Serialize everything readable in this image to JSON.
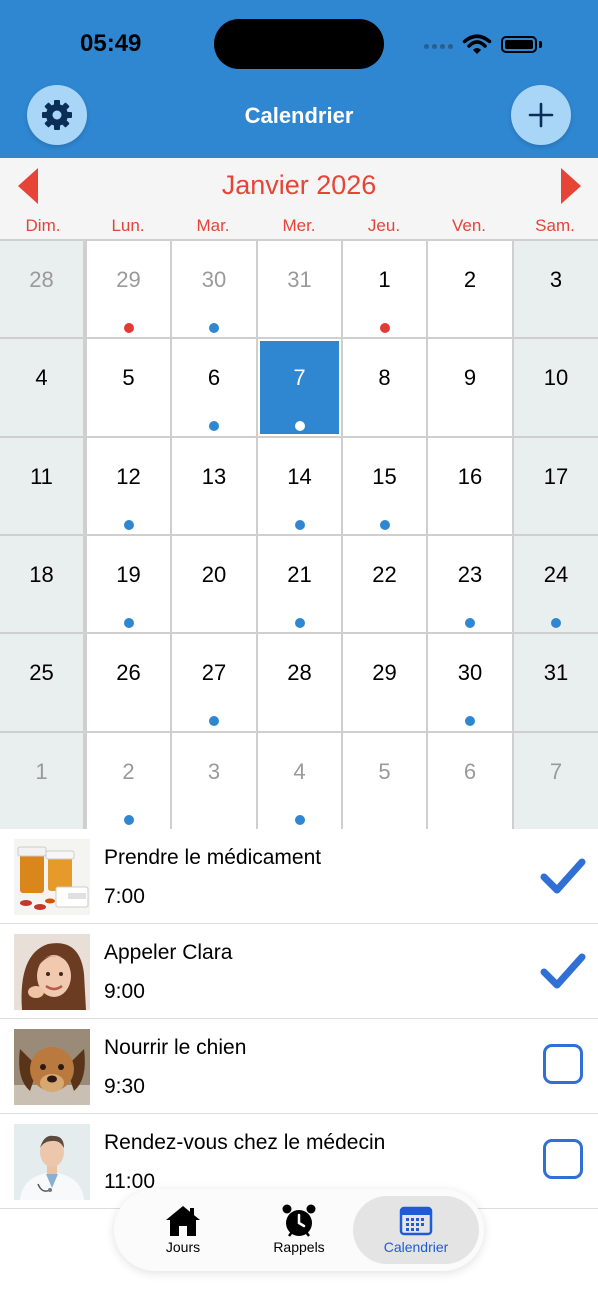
{
  "status": {
    "time": "05:49"
  },
  "header": {
    "title": "Calendrier",
    "settings_icon": "gear-icon",
    "add_icon": "plus-icon"
  },
  "calendar": {
    "month_title": "Janvier 2026",
    "weekdays": [
      "Dim.",
      "Lun.",
      "Mar.",
      "Mer.",
      "Jeu.",
      "Ven.",
      "Sam."
    ],
    "selected_day": "7",
    "weeks": [
      [
        {
          "d": "28",
          "out": true,
          "dot": ""
        },
        {
          "d": "29",
          "out": true,
          "dot": "red"
        },
        {
          "d": "30",
          "out": true,
          "dot": "blue"
        },
        {
          "d": "31",
          "out": true,
          "dot": ""
        },
        {
          "d": "1",
          "out": false,
          "dot": "red"
        },
        {
          "d": "2",
          "out": false,
          "dot": ""
        },
        {
          "d": "3",
          "out": false,
          "dot": ""
        }
      ],
      [
        {
          "d": "4",
          "out": false,
          "dot": ""
        },
        {
          "d": "5",
          "out": false,
          "dot": ""
        },
        {
          "d": "6",
          "out": false,
          "dot": "blue"
        },
        {
          "d": "7",
          "out": false,
          "dot": "white",
          "selected": true
        },
        {
          "d": "8",
          "out": false,
          "dot": ""
        },
        {
          "d": "9",
          "out": false,
          "dot": ""
        },
        {
          "d": "10",
          "out": false,
          "dot": ""
        }
      ],
      [
        {
          "d": "11",
          "out": false,
          "dot": ""
        },
        {
          "d": "12",
          "out": false,
          "dot": "blue"
        },
        {
          "d": "13",
          "out": false,
          "dot": ""
        },
        {
          "d": "14",
          "out": false,
          "dot": "blue"
        },
        {
          "d": "15",
          "out": false,
          "dot": "blue"
        },
        {
          "d": "16",
          "out": false,
          "dot": ""
        },
        {
          "d": "17",
          "out": false,
          "dot": ""
        }
      ],
      [
        {
          "d": "18",
          "out": false,
          "dot": ""
        },
        {
          "d": "19",
          "out": false,
          "dot": "blue"
        },
        {
          "d": "20",
          "out": false,
          "dot": ""
        },
        {
          "d": "21",
          "out": false,
          "dot": "blue"
        },
        {
          "d": "22",
          "out": false,
          "dot": ""
        },
        {
          "d": "23",
          "out": false,
          "dot": "blue"
        },
        {
          "d": "24",
          "out": false,
          "dot": "blue"
        }
      ],
      [
        {
          "d": "25",
          "out": false,
          "dot": ""
        },
        {
          "d": "26",
          "out": false,
          "dot": ""
        },
        {
          "d": "27",
          "out": false,
          "dot": "blue"
        },
        {
          "d": "28",
          "out": false,
          "dot": ""
        },
        {
          "d": "29",
          "out": false,
          "dot": ""
        },
        {
          "d": "30",
          "out": false,
          "dot": "blue"
        },
        {
          "d": "31",
          "out": false,
          "dot": ""
        }
      ],
      [
        {
          "d": "1",
          "out": true,
          "dot": ""
        },
        {
          "d": "2",
          "out": true,
          "dot": "blue"
        },
        {
          "d": "3",
          "out": true,
          "dot": ""
        },
        {
          "d": "4",
          "out": true,
          "dot": "blue"
        },
        {
          "d": "5",
          "out": true,
          "dot": ""
        },
        {
          "d": "6",
          "out": true,
          "dot": ""
        },
        {
          "d": "7",
          "out": true,
          "dot": ""
        }
      ]
    ]
  },
  "reminders": [
    {
      "title": "Prendre le médicament",
      "time": "7:00",
      "done": true,
      "image": "medication-image"
    },
    {
      "title": "Appeler Clara",
      "time": "9:00",
      "done": true,
      "image": "woman-portrait-image"
    },
    {
      "title": "Nourrir le chien",
      "time": "9:30",
      "done": false,
      "image": "dog-image"
    },
    {
      "title": "Rendez-vous chez le médecin",
      "time": "11:00",
      "done": false,
      "image": "doctor-image"
    }
  ],
  "tabbar": {
    "tabs": [
      {
        "label": "Jours",
        "icon": "home-icon",
        "active": false
      },
      {
        "label": "Rappels",
        "icon": "alarm-clock-icon",
        "active": false
      },
      {
        "label": "Calendrier",
        "icon": "calendar-icon",
        "active": true
      }
    ]
  },
  "colors": {
    "header_blue": "#2f86d1",
    "accent_red": "#e64436",
    "dot_blue": "#2f86d1",
    "dot_red": "#e53935",
    "weekend_bg": "#e8efee",
    "selected_bg": "#2f86d1",
    "tab_active": "#1f5bd8",
    "check_blue": "#2f6fd6"
  }
}
